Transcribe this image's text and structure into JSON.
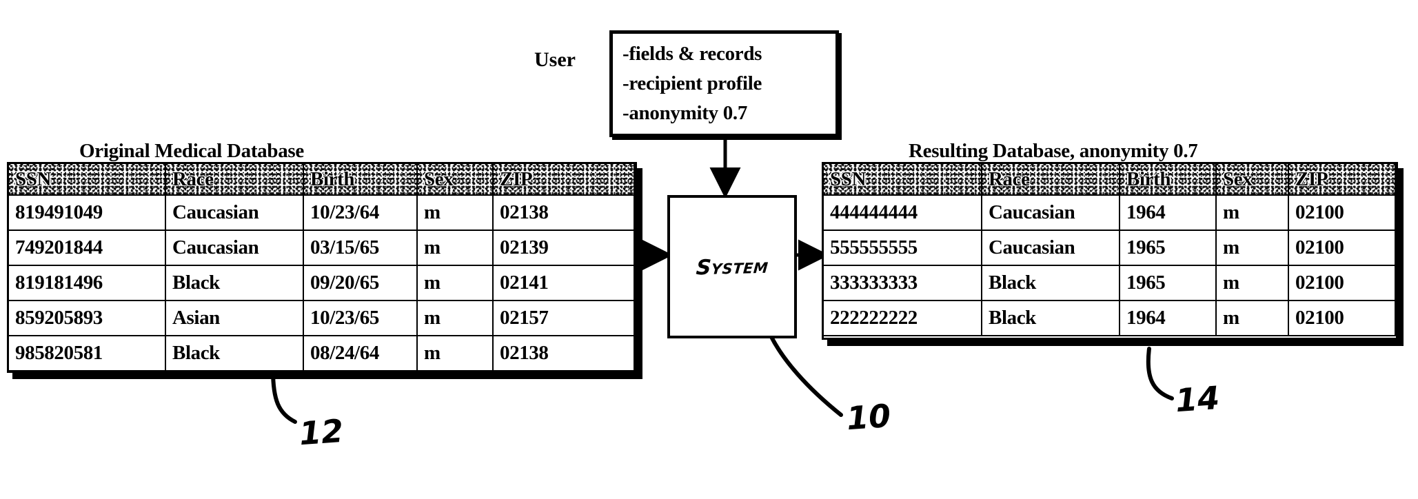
{
  "figure": {
    "user_label": "User",
    "system_label": "System",
    "user_box": {
      "lines": [
        "-fields & records",
        "-recipient profile",
        "-anonymity 0.7"
      ]
    },
    "numerals": {
      "system": "10",
      "original_table": "12",
      "resulting_table": "14"
    }
  },
  "original_table": {
    "title": "Original Medical Database",
    "columns": [
      "SSN",
      "Race",
      "Birth",
      "Sex",
      "ZIP"
    ],
    "rows": [
      [
        "819491049",
        "Caucasian",
        "10/23/64",
        "m",
        "02138"
      ],
      [
        "749201844",
        "Caucasian",
        "03/15/65",
        "m",
        "02139"
      ],
      [
        "819181496",
        "Black",
        "09/20/65",
        "m",
        "02141"
      ],
      [
        "859205893",
        "Asian",
        "10/23/65",
        "m",
        "02157"
      ],
      [
        "985820581",
        "Black",
        "08/24/64",
        "m",
        "02138"
      ]
    ]
  },
  "resulting_table": {
    "title": "Resulting Database, anonymity 0.7",
    "columns": [
      "SSN",
      "Race",
      "Birth",
      "Sex",
      "ZIP"
    ],
    "rows": [
      [
        "444444444",
        "Caucasian",
        "1964",
        "m",
        "02100"
      ],
      [
        "555555555",
        "Caucasian",
        "1965",
        "m",
        "02100"
      ],
      [
        "333333333",
        "Black",
        "1965",
        "m",
        "02100"
      ],
      [
        "222222222",
        "Black",
        "1964",
        "m",
        "02100"
      ]
    ]
  }
}
